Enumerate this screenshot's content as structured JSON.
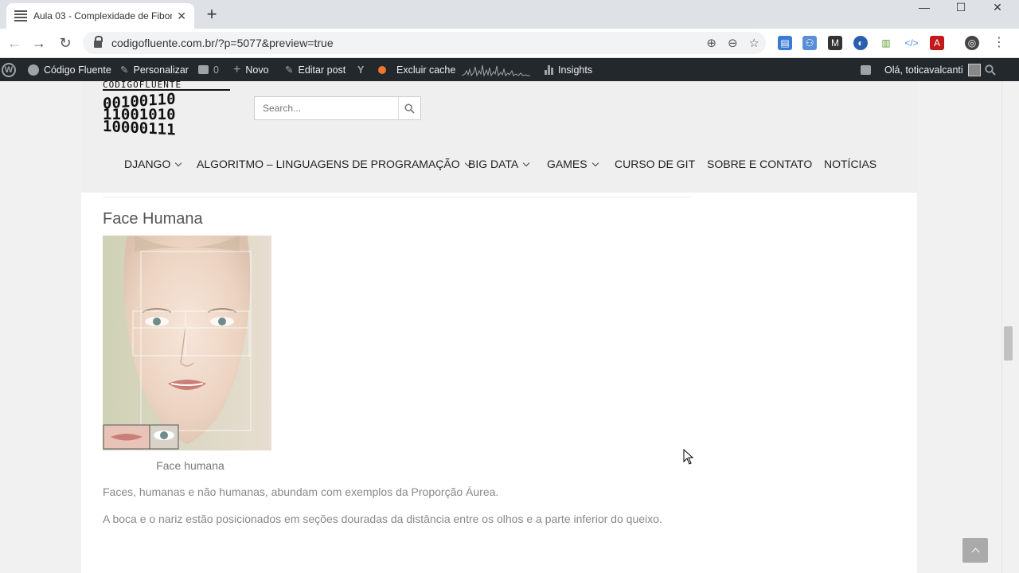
{
  "browser": {
    "tab_title": "Aula 03 - Complexidade de Fibon",
    "tab_close": "✕",
    "new_tab": "+",
    "url": "codigofluente.com.br/?p=5077&preview=true",
    "window": {
      "minimize": "—",
      "maximize": "☐",
      "close": "✕"
    }
  },
  "adminbar": {
    "site_name": "Código Fluente",
    "customize": "Personalizar",
    "comments_count": "0",
    "new": "Novo",
    "edit_post": "Editar post",
    "clear_cache": "Excluir cache",
    "insights": "Insights",
    "greeting": "Olá, toticavalcanti"
  },
  "site": {
    "logo_text": "CÓDIGOFLUENTE",
    "logo_rows": [
      "00100110",
      "11001010",
      "10000111"
    ],
    "search_placeholder": "Search...",
    "menu": [
      {
        "label": "DJANGO",
        "dropdown": true
      },
      {
        "label": "ALGORITMO – LINGUAGENS DE PROGRAMAÇÃO",
        "dropdown": true
      },
      {
        "label": "BIG DATA",
        "dropdown": true
      },
      {
        "label": "GAMES",
        "dropdown": true
      },
      {
        "label": "CURSO DE GIT",
        "dropdown": false
      },
      {
        "label": "SOBRE E CONTATO",
        "dropdown": false
      },
      {
        "label": "NOTÍCIAS",
        "dropdown": false
      }
    ]
  },
  "post": {
    "heading": "Face Humana",
    "caption": "Face humana",
    "paragraphs": [
      "Faces, humanas e não humanas, abundam com exemplos da Proporção Áurea.",
      "A boca e o nariz estão posicionados em seções douradas da distância entre os olhos e a parte inferior do queixo."
    ]
  },
  "colors": {
    "adminbar": "#23282d",
    "orange_dot": "#f0782d"
  }
}
